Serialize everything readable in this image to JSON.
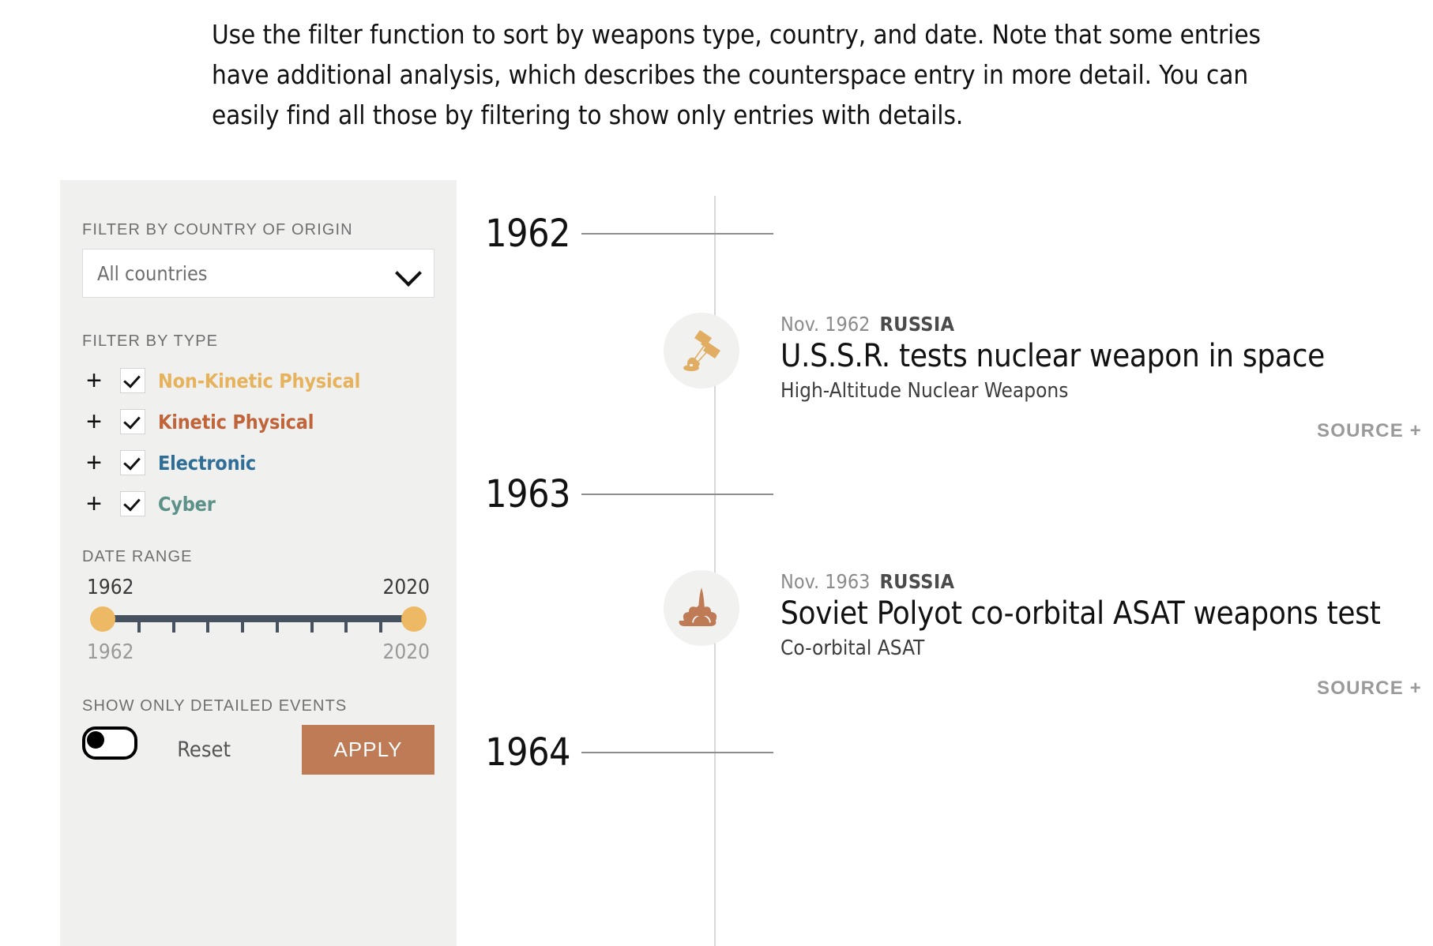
{
  "intro": {
    "paragraph": "Use the filter function to sort by weapons type, country, and date. Note that some entries have additional analysis, which describes the counterspace entry in more detail. You can easily find all those by filtering to show only entries with details."
  },
  "filters": {
    "country": {
      "label": "FILTER BY COUNTRY OF ORIGIN",
      "selected": "All countries",
      "icon": "chevron-down-icon"
    },
    "type": {
      "label": "FILTER BY TYPE",
      "expand_glyph": "+",
      "items": [
        {
          "label": "Non-Kinetic Physical",
          "color": "#e6b35c",
          "checked": true
        },
        {
          "label": "Kinetic Physical",
          "color": "#c1643a",
          "checked": true
        },
        {
          "label": "Electronic",
          "color": "#2f6e96",
          "checked": true
        },
        {
          "label": "Cyber",
          "color": "#5b9189",
          "checked": true
        }
      ]
    },
    "date_range": {
      "label": "DATE RANGE",
      "selected_min": "1962",
      "selected_max": "2020",
      "bound_min": "1962",
      "bound_max": "2020",
      "track_color": "#475260",
      "knob_color": "#eeb964",
      "tick_count": 9
    },
    "detailed_toggle": {
      "label": "SHOW ONLY DETAILED EVENTS",
      "on": false
    },
    "actions": {
      "reset_label": "Reset",
      "apply_label": "APPLY",
      "apply_color": "#bf7b55"
    }
  },
  "timeline": {
    "years": [
      {
        "label": "1962"
      },
      {
        "label": "1963"
      },
      {
        "label": "1964"
      }
    ],
    "events": [
      {
        "date": "Nov. 1962",
        "country": "RUSSIA",
        "title": "U.S.S.R. tests nuclear weapon in space",
        "category": "High-Altitude Nuclear Weapons",
        "source_label": "SOURCE +",
        "icon": "satellite-uplink-icon",
        "icon_color": "#e0ad62"
      },
      {
        "date": "Nov. 1963",
        "country": "RUSSIA",
        "title": "Soviet Polyot co-orbital ASAT weapons test",
        "category": "Co-orbital ASAT",
        "source_label": "SOURCE +",
        "icon": "rocket-launch-icon",
        "icon_color": "#bf7b55"
      }
    ]
  }
}
